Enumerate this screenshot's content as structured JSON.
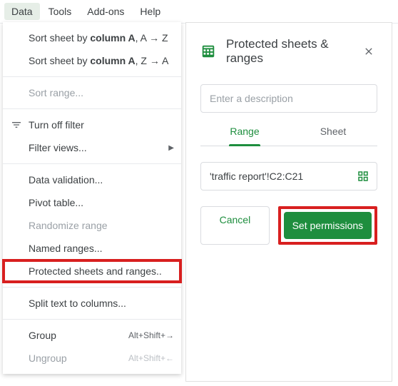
{
  "menubar": {
    "data": "Data",
    "tools": "Tools",
    "addons": "Add-ons",
    "help": "Help"
  },
  "dropdown": {
    "sort_az_pre": "Sort sheet by ",
    "sort_az_col": "column A",
    "sort_az_suf": ", A → Z",
    "sort_za_pre": "Sort sheet by ",
    "sort_za_col": "column A",
    "sort_za_suf": ", Z → A",
    "sort_range": "Sort range...",
    "turn_off_filter": "Turn off filter",
    "filter_views": "Filter views...",
    "data_validation": "Data validation...",
    "pivot_table": "Pivot table...",
    "randomize_range": "Randomize range",
    "named_ranges": "Named ranges...",
    "protected": "Protected sheets and ranges..",
    "split_text": "Split text to columns...",
    "group": "Group",
    "group_shortcut": "Alt+Shift+→",
    "ungroup": "Ungroup",
    "ungroup_shortcut": "Alt+Shift+←"
  },
  "panel": {
    "title": "Protected sheets & ranges",
    "desc_placeholder": "Enter a description",
    "tab_range": "Range",
    "tab_sheet": "Sheet",
    "range_value": "'traffic report'!C2:C21",
    "cancel": "Cancel",
    "set_permissions": "Set permissions"
  }
}
